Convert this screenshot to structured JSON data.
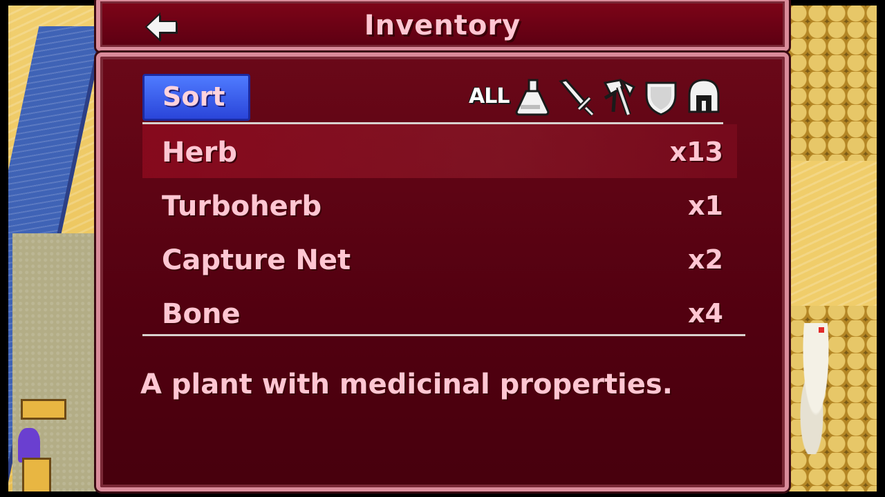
{
  "header": {
    "title": "Inventory",
    "back_icon": "back-arrow-icon"
  },
  "toolbar": {
    "sort_label": "Sort",
    "filter_all_label": "ALL",
    "filter_icons": [
      "potion-icon",
      "sword-icon",
      "axe-icon",
      "shield-icon",
      "helmet-icon"
    ]
  },
  "items": [
    {
      "name": "Herb",
      "qty": "x13",
      "selected": true
    },
    {
      "name": "Turboherb",
      "qty": "x1",
      "selected": false
    },
    {
      "name": "Capture Net",
      "qty": "x2",
      "selected": false
    },
    {
      "name": "Bone",
      "qty": "x4",
      "selected": false
    }
  ],
  "description": "A plant with medicinal properties.",
  "colors": {
    "panel": "#5c0012",
    "frame": "#d98b9a",
    "text": "#ffc6d2",
    "sort_button": "#3a5ff0"
  }
}
